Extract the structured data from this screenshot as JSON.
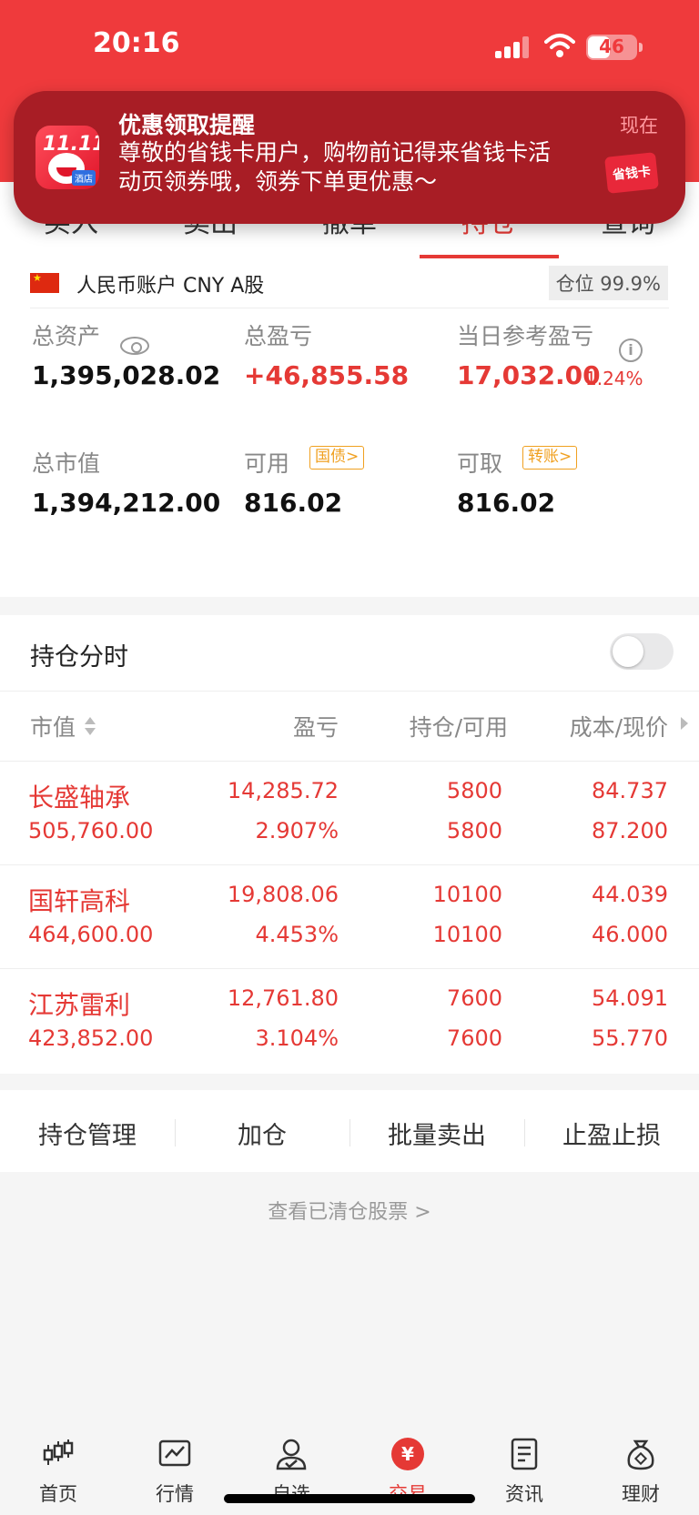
{
  "status_bar": {
    "time": "20:16",
    "battery": "46",
    "battery_level": 0.46
  },
  "notification": {
    "title": "优惠领取提醒",
    "body": "尊敬的省钱卡用户，购物前记得来省钱卡活动页领券哦，领券下单更优惠～",
    "time": "现在",
    "app_badge": "11.11",
    "hotel_tag": "酒店",
    "card_label": "省钱卡"
  },
  "tabs": [
    {
      "label": "买入"
    },
    {
      "label": "卖出"
    },
    {
      "label": "撤单"
    },
    {
      "label": "持仓"
    },
    {
      "label": "查询"
    }
  ],
  "account": {
    "name": "人民币账户 CNY A股",
    "position_ratio": "仓位 99.9%",
    "total_assets_label": "总资产",
    "total_assets": "1,395,028.02",
    "total_pnl_label": "总盈亏",
    "total_pnl": "+46,855.58",
    "daily_pnl_label": "当日参考盈亏",
    "daily_pnl": "17,032.00",
    "daily_pnl_pct": "1.24%",
    "market_value_label": "总市值",
    "market_value": "1,394,212.00",
    "available_label": "可用",
    "available_tag": "国债>",
    "available": "816.02",
    "withdrawable_label": "可取",
    "withdrawable_tag": "转账>",
    "withdrawable": "816.02"
  },
  "holdings": {
    "title": "持仓分时",
    "toggle_on": false,
    "headers": {
      "market_value": "市值",
      "pnl": "盈亏",
      "position": "持仓/可用",
      "cost_price": "成本/现价"
    },
    "rows": [
      {
        "name": "长盛轴承",
        "market_value": "505,760.00",
        "pnl": "14,285.72",
        "pnl_pct": "2.907%",
        "hold": "5800",
        "available": "5800",
        "cost": "84.737",
        "price": "87.200"
      },
      {
        "name": "国轩高科",
        "market_value": "464,600.00",
        "pnl": "19,808.06",
        "pnl_pct": "4.453%",
        "hold": "10100",
        "available": "10100",
        "cost": "44.039",
        "price": "46.000"
      },
      {
        "name": "江苏雷利",
        "market_value": "423,852.00",
        "pnl": "12,761.80",
        "pnl_pct": "3.104%",
        "hold": "7600",
        "available": "7600",
        "cost": "54.091",
        "price": "55.770"
      }
    ]
  },
  "actions": [
    {
      "label": "持仓管理"
    },
    {
      "label": "加仓"
    },
    {
      "label": "批量卖出"
    },
    {
      "label": "止盈止损"
    }
  ],
  "cleared_link": "查看已清仓股票 >",
  "bottom_nav": [
    {
      "label": "首页",
      "icon": "candlestick-icon"
    },
    {
      "label": "行情",
      "icon": "chart-icon"
    },
    {
      "label": "自选",
      "icon": "person-check-icon"
    },
    {
      "label": "交易",
      "icon": "yuan-icon",
      "active": true
    },
    {
      "label": "资讯",
      "icon": "document-icon"
    },
    {
      "label": "理财",
      "icon": "money-bag-icon"
    }
  ],
  "colors": {
    "brand_red": "#ef3a3c",
    "gain_red": "#e53935",
    "tag_orange": "#f0a020"
  }
}
